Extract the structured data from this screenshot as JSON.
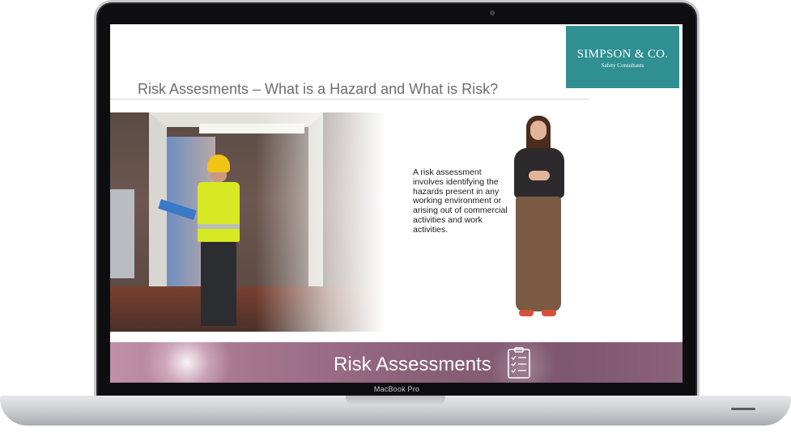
{
  "device": {
    "brand_label": "MacBook Pro"
  },
  "slide": {
    "title": "Risk Assesments – What is a Hazard and What is Risk?",
    "brand": {
      "name": "SIMPSON & CO.",
      "subtitle": "Safety Consultants",
      "color": "#2f8f91"
    },
    "body_text": "A risk assessment involves identifying the hazards present in any working environment or arising out of commercial activities and work activities.",
    "banner": {
      "title": "Risk Assessments",
      "icon": "checklist-icon"
    }
  }
}
